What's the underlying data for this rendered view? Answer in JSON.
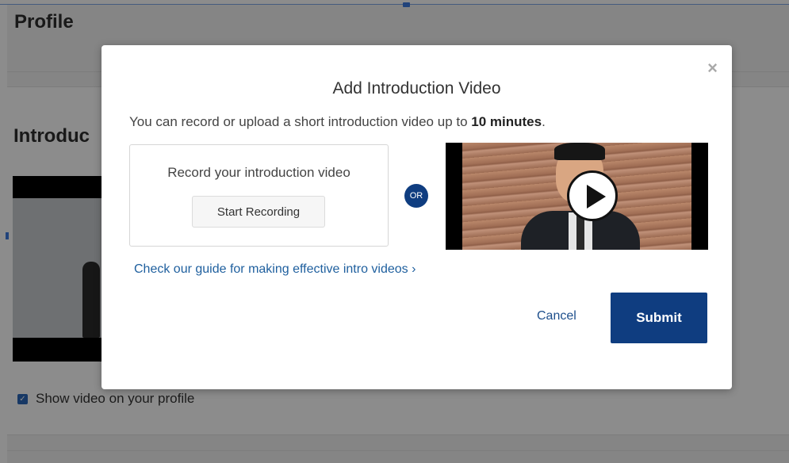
{
  "page": {
    "title": "Profile",
    "section_title": "Introduc",
    "show_video_label": "Show video on your profile",
    "show_video_checked": true
  },
  "modal": {
    "title": "Add Introduction Video",
    "description_prefix": "You can record or upload a short introduction video up to ",
    "description_bold": "10 minutes",
    "description_suffix": ".",
    "record_label": "Record your introduction video",
    "start_recording_label": "Start Recording",
    "or_label": "OR",
    "guide_link_label": "Check our guide for making effective intro videos ›",
    "cancel_label": "Cancel",
    "submit_label": "Submit",
    "close_icon": "×"
  },
  "colors": {
    "primary": "#0f3d80",
    "link": "#1e5f9e",
    "checkbox": "#2a66b8"
  },
  "icons": {
    "close": "close-icon",
    "play": "play-icon",
    "checkbox": "checkbox-checked-icon",
    "chevron": "chevron-right-icon"
  }
}
